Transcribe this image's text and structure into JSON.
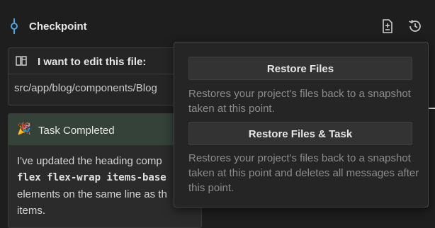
{
  "checkpoint": {
    "title": "Checkpoint",
    "icons": [
      "commit-icon",
      "file-compare-icon",
      "history-icon"
    ]
  },
  "edit_request": {
    "title": "I want to edit this file:",
    "path": "src/app/blog/components/Blog",
    "icon": "split-view-icon"
  },
  "task": {
    "title": "Task Completed",
    "icon": "party-popper-icon",
    "body_lines": [
      {
        "text": "I've updated the heading comp",
        "code": ""
      },
      {
        "text": "",
        "code": "flex flex-wrap items-base"
      },
      {
        "text": "elements on the same line as th",
        "code": ""
      },
      {
        "text": "items.",
        "code": ""
      }
    ]
  },
  "restore_menu": {
    "restore_files_label": "Restore Files",
    "restore_files_desc": "Restores your project's files back to a snapshot taken at this point.",
    "restore_files_task_label": "Restore Files & Task",
    "restore_files_task_desc": "Restores your project's files back to a snapshot taken at this point and deletes all messages after this point."
  },
  "colors": {
    "background": "#1e1e1e",
    "accent_blue": "#4fa3e0",
    "task_header": "#34423a"
  }
}
